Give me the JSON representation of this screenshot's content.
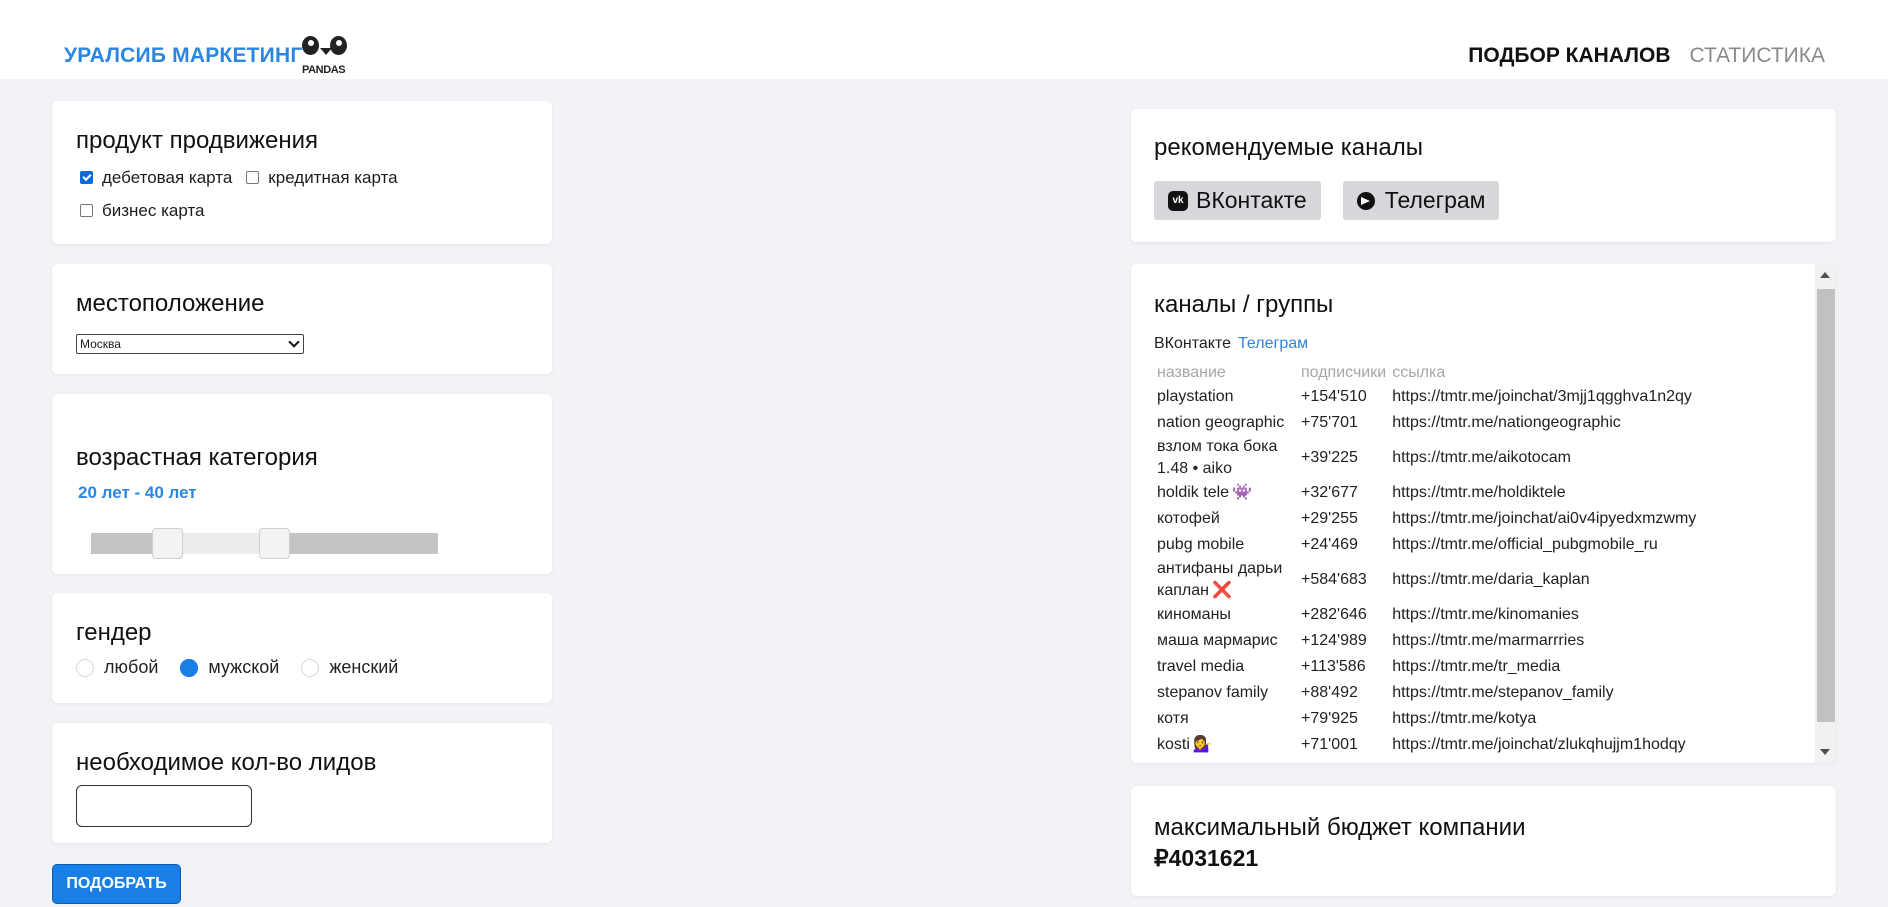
{
  "header": {
    "brand": "УРАЛСИБ МАРКЕТИНГ",
    "logo_text": "PANDAS",
    "nav": {
      "active": "ПОДБОР КАНАЛОВ",
      "inactive": "СТАТИСТИКА"
    }
  },
  "product": {
    "title": "продукт продвижения",
    "options": [
      {
        "label": "дебетовая карта",
        "checked": true
      },
      {
        "label": "кредитная карта",
        "checked": false
      },
      {
        "label": "бизнес карта",
        "checked": false
      }
    ]
  },
  "location": {
    "title": "местоположение",
    "selected": "Москва"
  },
  "age": {
    "title": "возрастная категория",
    "range_label": "20 лет - 40 лет",
    "slider_low_fraction": 0.22,
    "slider_high_fraction": 0.53
  },
  "gender": {
    "title": "гендер",
    "options": [
      {
        "label": "любой",
        "selected": false
      },
      {
        "label": "мужской",
        "selected": true
      },
      {
        "label": "женский",
        "selected": false
      }
    ]
  },
  "leads": {
    "title": "необходимое кол-во лидов",
    "value": ""
  },
  "submit_label": "ПОДОБРАТЬ",
  "recommended": {
    "title": "рекомендуемые каналы",
    "buttons": [
      {
        "label": "ВКонтакте",
        "icon": "vk-icon"
      },
      {
        "label": "Телеграм",
        "icon": "telegram-icon"
      }
    ]
  },
  "channels": {
    "title": "каналы / группы",
    "tabs": {
      "vk": "ВКонтакте",
      "tg": "Телеграм"
    },
    "columns": [
      "название",
      "подписчики",
      "ссылка"
    ],
    "rows": [
      {
        "name": "playstation",
        "subs": "+154'510",
        "link": "https://tmtr.me/joinchat/3mjj1qgghva1n2qy"
      },
      {
        "name": "nation geographic",
        "subs": "+75'701",
        "link": "https://tmtr.me/nationgeographic"
      },
      {
        "name": "взлом тока бока 1.48 • aiko",
        "subs": "+39'225",
        "link": "https://tmtr.me/aikotocam"
      },
      {
        "name": "holdik tele",
        "emoji": "👾",
        "subs": "+32'677",
        "link": "https://tmtr.me/holdiktele"
      },
      {
        "name": "котофей",
        "subs": "+29'255",
        "link": "https://tmtr.me/joinchat/ai0v4ipyedxmzwmy"
      },
      {
        "name": "pubg mobile",
        "subs": "+24'469",
        "link": "https://tmtr.me/official_pubgmobile_ru"
      },
      {
        "name": "антифаны дарьи каплан",
        "emoji": "❌",
        "subs": "+584'683",
        "link": "https://tmtr.me/daria_kaplan"
      },
      {
        "name": "киноманы",
        "subs": "+282'646",
        "link": "https://tmtr.me/kinomanies"
      },
      {
        "name": "маша мармарис",
        "subs": "+124'989",
        "link": "https://tmtr.me/marmarrries"
      },
      {
        "name": "travel media",
        "subs": "+113'586",
        "link": "https://tmtr.me/tr_media"
      },
      {
        "name": "stepanov family",
        "subs": "+88'492",
        "link": "https://tmtr.me/stepanov_family"
      },
      {
        "name": "котя",
        "subs": "+79'925",
        "link": "https://tmtr.me/kotya"
      },
      {
        "name": "kosti",
        "emoji": "💁‍♀️",
        "subs": "+71'001",
        "link": "https://tmtr.me/joinchat/zlukqhujjm1hodqy"
      }
    ]
  },
  "budget": {
    "title": "максимальный бюджет компании",
    "value": "₽4031621"
  }
}
